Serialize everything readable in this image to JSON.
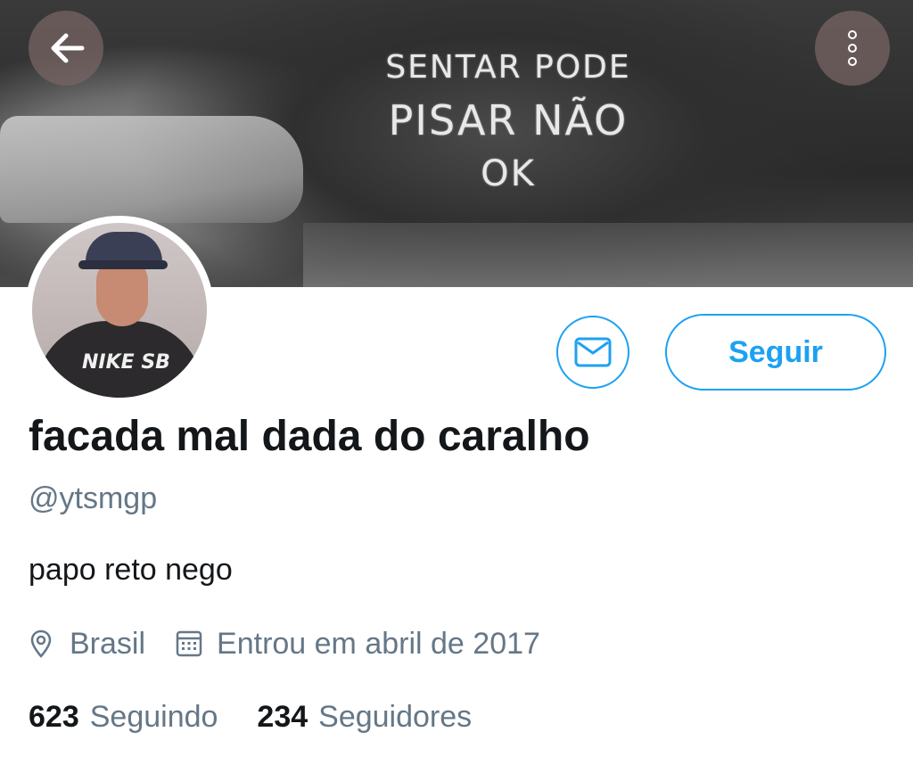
{
  "header": {
    "banner_text": [
      "SENTAR PODE",
      "PISAR NÃO",
      "OK"
    ],
    "back_icon": "arrow-left-icon",
    "more_icon": "more-vertical-icon"
  },
  "profile": {
    "display_name": "facada mal dada do caralho",
    "handle": "@ytsmgp",
    "bio": "papo reto nego",
    "location": "Brasil",
    "joined": "Entrou em abril de 2017",
    "avatar_logo": "NIKE SB"
  },
  "actions": {
    "message_icon": "envelope-icon",
    "follow_label": "Seguir"
  },
  "stats": {
    "following_count": "623",
    "following_label": "Seguindo",
    "followers_count": "234",
    "followers_label": "Seguidores"
  },
  "colors": {
    "accent": "#1da1f2",
    "text_primary": "#14171a",
    "text_secondary": "#657786"
  }
}
